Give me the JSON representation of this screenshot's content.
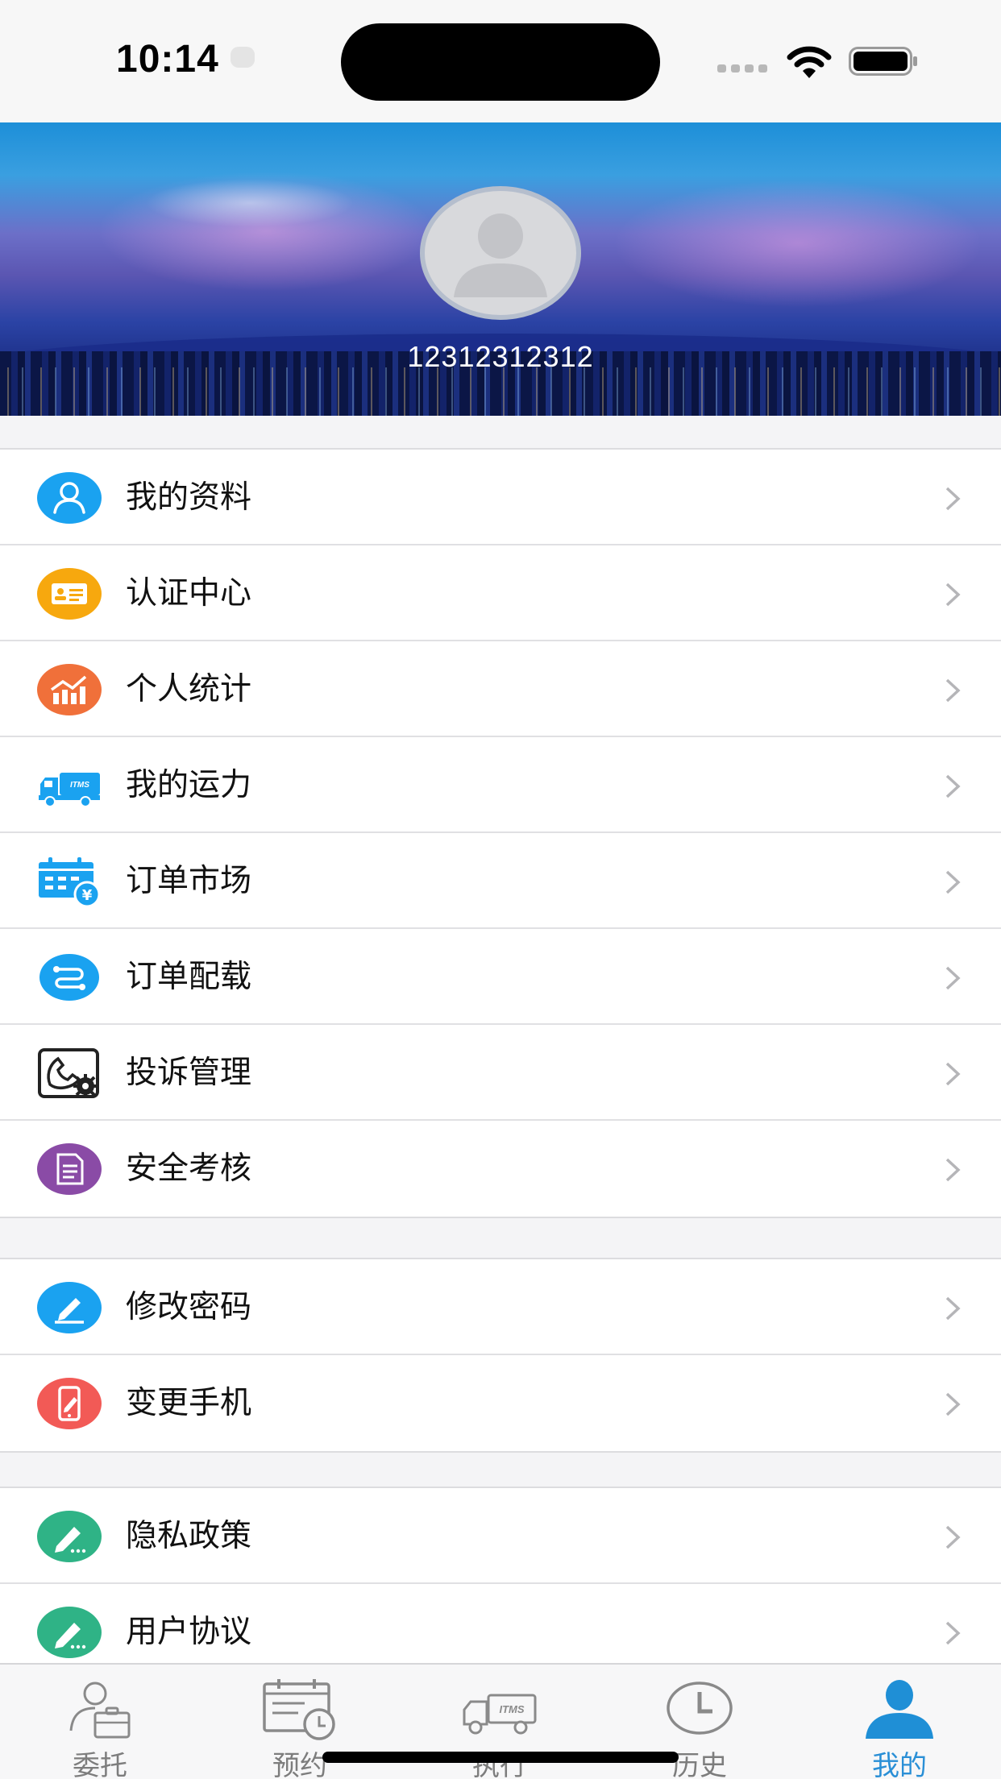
{
  "status_bar": {
    "time": "10:14"
  },
  "profile": {
    "username": "12312312312"
  },
  "menu_groups": [
    [
      {
        "label": "我的资料",
        "icon": "user-icon",
        "color": "#1aa2f0"
      },
      {
        "label": "认证中心",
        "icon": "id-card-icon",
        "color": "#f7a80e"
      },
      {
        "label": "个人统计",
        "icon": "statistics-icon",
        "color": "#f0703a"
      },
      {
        "label": "我的运力",
        "icon": "truck-icon",
        "color": "#1aa2f0"
      },
      {
        "label": "订单市场",
        "icon": "order-calendar-icon",
        "color": "#1aa2f0"
      },
      {
        "label": "订单配载",
        "icon": "route-icon",
        "color": "#1aa2f0"
      },
      {
        "label": "投诉管理",
        "icon": "phone-settings-icon",
        "color": "#222222"
      },
      {
        "label": "安全考核",
        "icon": "document-icon",
        "color": "#8a4ba6"
      }
    ],
    [
      {
        "label": "修改密码",
        "icon": "pencil-icon",
        "color": "#1aa2f0"
      },
      {
        "label": "变更手机",
        "icon": "phone-edit-icon",
        "color": "#f25a56"
      }
    ],
    [
      {
        "label": "隐私政策",
        "icon": "pen-icon",
        "color": "#2fb386"
      },
      {
        "label": "用户协议",
        "icon": "pen-icon",
        "color": "#2fb386"
      }
    ]
  ],
  "tabs": [
    {
      "label": "委托",
      "icon": "briefcase-person-icon",
      "active": false
    },
    {
      "label": "预约",
      "icon": "calendar-clock-icon",
      "active": false
    },
    {
      "label": "执行",
      "icon": "truck-icon",
      "active": false
    },
    {
      "label": "历史",
      "icon": "clock-icon",
      "active": false
    },
    {
      "label": "我的",
      "icon": "person-icon",
      "active": true
    }
  ],
  "colors": {
    "accent": "#2a8fd6",
    "inactive_tab": "#7d7d7d"
  }
}
